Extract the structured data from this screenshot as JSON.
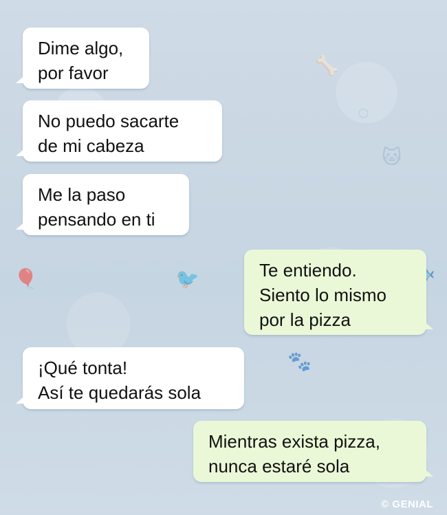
{
  "messages": [
    {
      "direction": "incoming",
      "lines": [
        "Dime algo,",
        "por favor"
      ]
    },
    {
      "direction": "incoming",
      "lines": [
        "No puedo sacarte",
        "de mi cabeza"
      ]
    },
    {
      "direction": "incoming",
      "lines": [
        "Me la paso",
        "pensando en ti"
      ]
    },
    {
      "direction": "outgoing",
      "lines": [
        "Te entiendo.",
        "Siento lo mismo",
        "por la pizza"
      ]
    },
    {
      "direction": "incoming",
      "lines": [
        "¡Qué tonta!",
        "Así te quedarás sola"
      ]
    },
    {
      "direction": "outgoing",
      "lines": [
        "Mientras exista pizza,",
        "nunca estaré sola"
      ]
    }
  ],
  "watermark": "© GENIAL",
  "colors": {
    "background": "#cfdbe6",
    "incoming_bubble": "#ffffff",
    "outgoing_bubble": "#eaf8d7",
    "text": "#111111"
  },
  "background_icons": [
    "bone-icon",
    "ball-icon",
    "cat-icon",
    "fish-icon",
    "paw-icon",
    "bird-icon",
    "balloon-icon"
  ]
}
